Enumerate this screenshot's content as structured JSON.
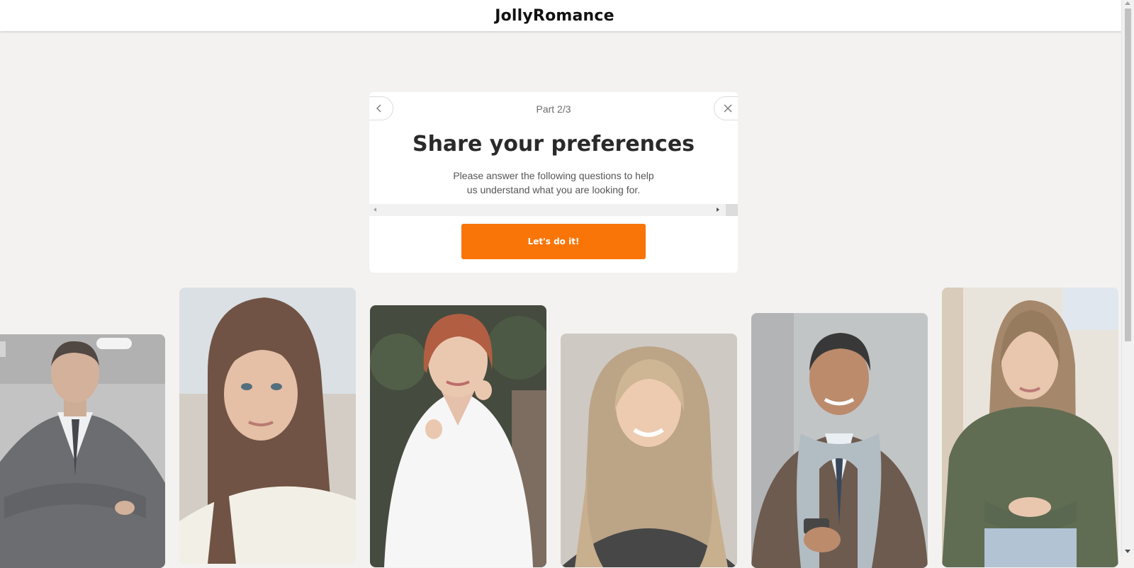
{
  "brand": {
    "name": "JollyRomance"
  },
  "modal": {
    "part": "Part 2/3",
    "title": "Share your preferences",
    "subtitle_line1": "Please answer the following questions to help",
    "subtitle_line2": "us understand what you are looking for.",
    "cta_label": "Let's do it!",
    "back_icon": "chevron-left-icon",
    "close_icon": "close-icon"
  },
  "colors": {
    "accent": "#f97508",
    "page_bg": "#f3f2f1"
  },
  "profiles": [
    {
      "id": "profile-1",
      "description": "man in grey suit with crossed arms"
    },
    {
      "id": "profile-2",
      "description": "woman with long brown hair"
    },
    {
      "id": "profile-3",
      "description": "red-haired woman in white shirt"
    },
    {
      "id": "profile-4",
      "description": "blonde woman with wavy hair"
    },
    {
      "id": "profile-5",
      "description": "man with grey scarf holding phone"
    },
    {
      "id": "profile-6",
      "description": "woman in green sweater"
    }
  ]
}
